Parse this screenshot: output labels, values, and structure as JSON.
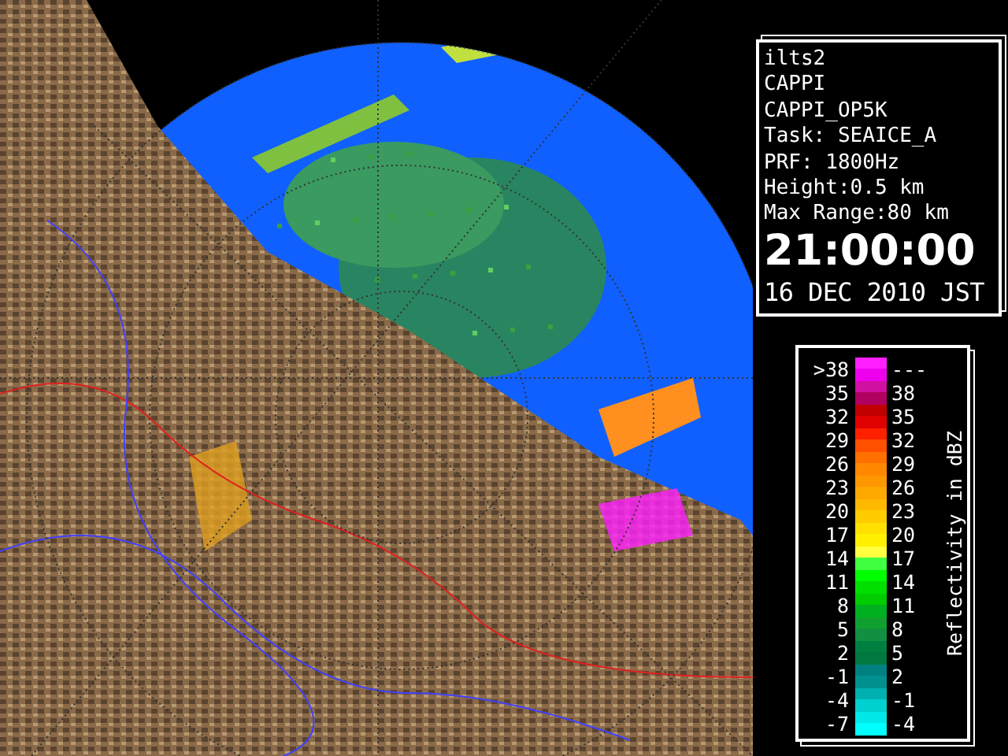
{
  "info_panel": {
    "lines": [
      "ilts2",
      "CAPPI",
      "CAPPI_OP5K",
      "Task: SEAICE_A",
      "PRF: 1800Hz",
      "Height:0.5 km",
      "Max Range:80 km"
    ],
    "time": "21:00:00",
    "date": "16 DEC 2010 JST"
  },
  "legend": {
    "axis_label": "Reflectivity in dBZ",
    "rows": [
      {
        "low": ">38",
        "high": "---",
        "segments": [
          {
            "color": "#ff20ff"
          },
          {
            "color": "#ee00ee"
          }
        ]
      },
      {
        "low": "35",
        "high": "38",
        "segments": [
          {
            "color": "#d010a0"
          },
          {
            "color": "#b00060"
          }
        ]
      },
      {
        "low": "32",
        "high": "35",
        "segments": [
          {
            "color": "#c00000"
          },
          {
            "color": "#e00000"
          }
        ]
      },
      {
        "low": "29",
        "high": "32",
        "segments": [
          {
            "color": "#ff2000"
          },
          {
            "color": "#ff5000"
          }
        ]
      },
      {
        "low": "26",
        "high": "29",
        "segments": [
          {
            "color": "#ff7000"
          },
          {
            "color": "#ff8800"
          }
        ]
      },
      {
        "low": "23",
        "high": "26",
        "segments": [
          {
            "color": "#ff9800"
          },
          {
            "color": "#ffa800"
          }
        ]
      },
      {
        "low": "20",
        "high": "23",
        "segments": [
          {
            "color": "#ffb800"
          },
          {
            "color": "#ffcc00"
          }
        ]
      },
      {
        "low": "17",
        "high": "20",
        "segments": [
          {
            "color": "#ffe000"
          },
          {
            "color": "#fff000"
          }
        ]
      },
      {
        "low": "14",
        "high": "17",
        "segments": [
          {
            "color": "#ffff40"
          },
          {
            "color": "#40ff40"
          }
        ]
      },
      {
        "low": "11",
        "high": "14",
        "segments": [
          {
            "color": "#00ff00"
          },
          {
            "color": "#00e000"
          }
        ]
      },
      {
        "low": "8",
        "high": "11",
        "segments": [
          {
            "color": "#00cc00"
          },
          {
            "color": "#00b020"
          }
        ]
      },
      {
        "low": "5",
        "high": "8",
        "segments": [
          {
            "color": "#10a030"
          },
          {
            "color": "#109040"
          }
        ]
      },
      {
        "low": "2",
        "high": "5",
        "segments": [
          {
            "color": "#008040"
          },
          {
            "color": "#007840"
          }
        ]
      },
      {
        "low": "-1",
        "high": "2",
        "segments": [
          {
            "color": "#008080"
          },
          {
            "color": "#009090"
          }
        ]
      },
      {
        "low": "-4",
        "high": "-1",
        "segments": [
          {
            "color": "#00b0b0"
          },
          {
            "color": "#00d0d0"
          }
        ]
      },
      {
        "low": "-7",
        "high": "-4",
        "segments": [
          {
            "color": "#00e8e8"
          },
          {
            "color": "#00ffff"
          }
        ]
      }
    ]
  }
}
